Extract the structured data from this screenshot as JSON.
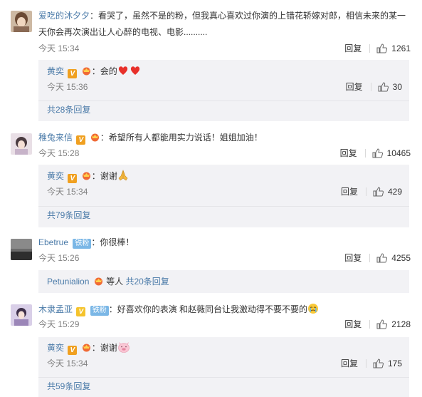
{
  "comments": [
    {
      "user": "爱吃的沐夕夕",
      "text": "看哭了，虽然不是的粉，但我真心喜欢过你演的上错花轿嫁对郎，相信未来的某一天你会再次演出让人心醉的电视、电影..........",
      "text_line1": "看哭了，虽然不是的粉，但我真心喜欢过你演的上错花轿嫁对郎，相信未来的某一",
      "text_line2": "天你会再次演出让人心醉的电视、电影..........",
      "time": "今天 15:34",
      "reply": "回复",
      "likes": "1261",
      "sub": {
        "user": "黄奕",
        "text": "会的",
        "time": "今天 15:36",
        "reply": "回复",
        "likes": "30",
        "more": "共28条回复"
      }
    },
    {
      "user": "稚兔来信",
      "text": "希望所有人都能用实力说话！姐姐加油！",
      "time": "今天 15:28",
      "reply": "回复",
      "likes": "10465",
      "sub": {
        "user": "黄奕",
        "text": "谢谢",
        "time": "今天 15:34",
        "reply": "回复",
        "likes": "429",
        "more": "共79条回复"
      }
    },
    {
      "user": "Ebetrue",
      "badge": "铁粉",
      "text": "你很棒！",
      "time": "今天 15:26",
      "reply": "回复",
      "likes": "4255",
      "sub": {
        "user": "Petunialion",
        "text": "等人",
        "more": "共20条回复"
      }
    },
    {
      "user": "木隶孟亚",
      "badge": "铁粉",
      "text": "好喜欢你的表演 和赵薇同台让我激动得不要不要的",
      "time": "今天 15:29",
      "reply": "回复",
      "likes": "2128",
      "sub": {
        "user": "黄奕",
        "text": "谢谢",
        "time": "今天 15:34",
        "reply": "回复",
        "likes": "175",
        "more": "共59条回复"
      }
    }
  ],
  "badge_v_letter": "V",
  "colors": {
    "username": "#eb7350",
    "link": "#4a7aa8",
    "muted": "#808080",
    "subbox_bg": "#f2f2f5",
    "fan_badge": "#7bb7e6",
    "v_badge": "#f0a020"
  },
  "icons": [
    "thumb-up-icon",
    "v-badge-icon",
    "vip-crown-icon",
    "heart-icon",
    "pray-emoji-icon",
    "cry-emoji-icon",
    "pig-emoji-icon"
  ]
}
